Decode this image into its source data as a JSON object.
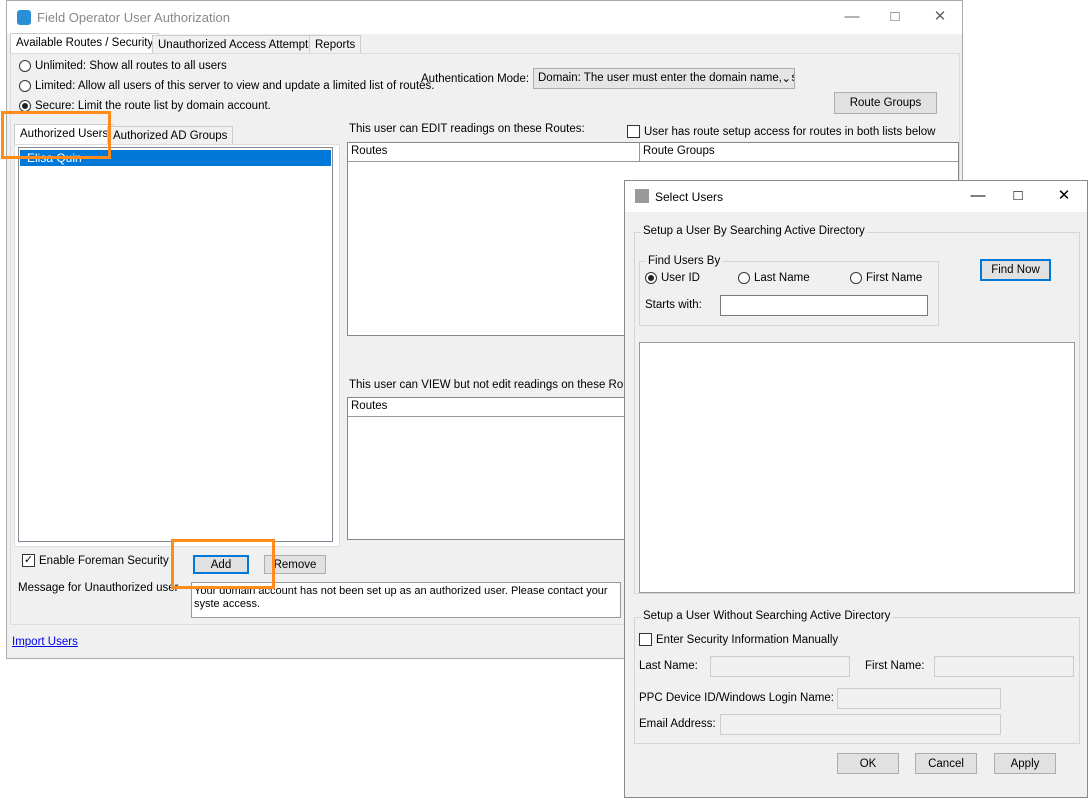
{
  "main_window": {
    "title": "Field Operator User Authorization",
    "tabs": [
      "Available Routes / Security",
      "Unauthorized Access Attempts",
      "Reports"
    ],
    "security_modes": [
      {
        "label": "Unlimited: Show all routes to all users",
        "selected": false
      },
      {
        "label": "Limited: Allow all users of this server to view and update a limited list of routes.",
        "selected": false
      },
      {
        "label": "Secure: Limit the route list by domain account.",
        "selected": true
      }
    ],
    "auth_mode_label": "Authentication Mode:",
    "auth_mode_value": "Domain:  The user must enter the domain name, us",
    "route_groups_button": "Route Groups",
    "user_tabs": [
      "Authorized Users",
      "Authorized AD Groups"
    ],
    "users": [
      "Elisa Quin"
    ],
    "edit_label": "This user can EDIT readings on these Routes:",
    "route_setup_checkbox": "User has route setup access for routes in both lists below",
    "route_setup_checked": false,
    "edit_columns": [
      "Routes",
      "Route Groups"
    ],
    "view_label": "This user can VIEW but not edit readings on these Route",
    "view_columns": [
      "Routes"
    ],
    "foreman_checkbox": "Enable Foreman Security",
    "foreman_checked": true,
    "add_button": "Add",
    "remove_button": "Remove",
    "message_label": "Message for Unauthorized user",
    "message_value": "Your domain account has not been set up as an authorized user.  Please contact your syste access.",
    "import_link": "Import Users"
  },
  "dialog": {
    "title": "Select Users",
    "search_group": "Setup a User By Searching Active Directory",
    "find_group": "Find Users By",
    "find_options": [
      {
        "label": "User ID",
        "selected": true
      },
      {
        "label": "Last Name",
        "selected": false
      },
      {
        "label": "First Name",
        "selected": false
      }
    ],
    "starts_with_label": "Starts with:",
    "starts_with_value": "",
    "find_now_button": "Find Now",
    "manual_group": "Setup a User Without Searching Active Directory",
    "manual_checkbox": "Enter Security Information Manually",
    "manual_checked": false,
    "last_name_label": "Last Name:",
    "first_name_label": "First Name:",
    "device_id_label": "PPC Device ID/Windows Login Name:",
    "email_label": "Email Address:",
    "ok_button": "OK",
    "cancel_button": "Cancel",
    "apply_button": "Apply"
  }
}
